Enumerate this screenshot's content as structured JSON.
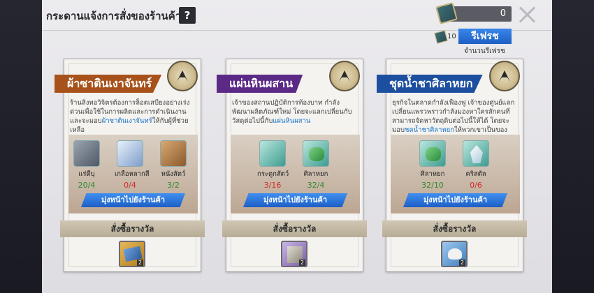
{
  "header": {
    "title": "กระดานแจ้งการสั่งของร้านค้า",
    "help_label": "?",
    "currency_value": "0"
  },
  "refresh": {
    "cost": "10",
    "button_label": "รีเฟรช",
    "caption": "จำนวนรีเฟรช"
  },
  "cards": [
    {
      "name": "ผ้าซาตินเงาจันทร์",
      "banner_color": "#a8521b",
      "desc_before": "ร้านสิ่งทอวิจิตรต้องการล็อตเสบียงอย่างเร่งด่วนเพื่อใช้ในการผลิตและการดำเนินงาน และจะมอบ",
      "desc_highlight": "ผ้าซาตินเงาจันทร์",
      "desc_after": "ให้กับผู้ที่ช่วยเหลือ",
      "materials": [
        {
          "name": "แร่ดีบุ",
          "count": "20/4",
          "ok": true,
          "color": "#6b7480"
        },
        {
          "name": "เกลือหลากสี",
          "count": "0/4",
          "ok": false,
          "color": "#9fb8d8"
        },
        {
          "name": "หนังสัตว์",
          "count": "3/2",
          "ok": true,
          "color": "#b98b55"
        }
      ],
      "goto_label": "มุ่งหน้าไปยังร้านค้า",
      "reward_label": "สั่งซื้อรางวัล",
      "reward_qty": "2",
      "reward_color": "#3f6fae"
    },
    {
      "name": "แผ่นหินผสาน",
      "banner_color": "#5b2a86",
      "desc_before": "เจ้าของสถานปฏิบัติการท้องบาท กำลังพัฒนาผลิตภัณฑ์ใหม่ โดยจะแลกเปลี่ยนกับวัสดุต่อไปนี้กับ",
      "desc_highlight": "แผ่นหินผสาน",
      "desc_after": "",
      "materials": [
        {
          "name": "กระดูกสัตว์",
          "count": "3/16",
          "ok": false,
          "color": "#d9e5e0"
        },
        {
          "name": "ศิลาหยก",
          "count": "32/4",
          "ok": true,
          "color": "#45a354"
        }
      ],
      "goto_label": "มุ่งหน้าไปยังร้านค้า",
      "reward_label": "สั่งซื้อรางวัล",
      "reward_qty": "2",
      "reward_color": "#8c8678"
    },
    {
      "name": "ชุดน้ำชาศิลาหยก",
      "banner_color": "#1d4fa0",
      "desc_before": "ธุรกิจในตลาดกำลังเฟื่องฟู เจ้าของศูนย์แลกเปลี่ยนแพรวพราวกำลังมองหาใครสักคนที่สามารถจัดหาวัตถุดิบต่อไปนี้ให้ได้ โดยจะมอบ",
      "desc_highlight": "ชุดน้ำชาศิลาหยก",
      "desc_after": "ให้พวกเขาเป็นของขวัญ",
      "materials": [
        {
          "name": "ศิลาหยก",
          "count": "32/10",
          "ok": true,
          "color": "#45a354"
        },
        {
          "name": "คริสตัล",
          "count": "0/6",
          "ok": false,
          "color": "#cfe3ef"
        }
      ],
      "goto_label": "มุ่งหน้าไปยังร้านค้า",
      "reward_label": "สั่งซื้อรางวัล",
      "reward_qty": "2",
      "reward_color": "#6fa3d9"
    }
  ]
}
